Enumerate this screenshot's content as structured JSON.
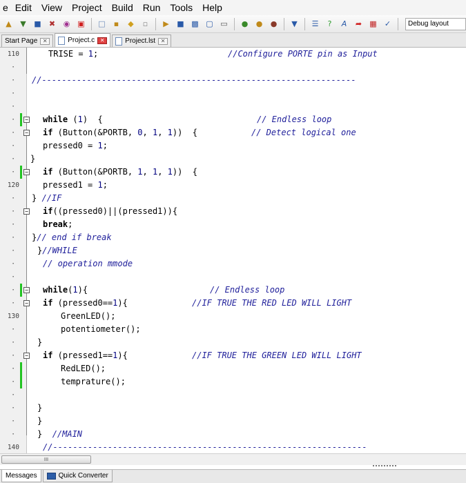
{
  "menu": [
    "Edit",
    "View",
    "Project",
    "Build",
    "Run",
    "Tools",
    "Help"
  ],
  "menu_partial": "e",
  "toolbar": {
    "layout_selected": "Debug layout"
  },
  "tabs": [
    {
      "label": "Start Page",
      "active": false
    },
    {
      "label": "Project.c",
      "active": true
    },
    {
      "label": "Project.lst",
      "active": false
    }
  ],
  "line_numbers": [
    {
      "row": 0,
      "label": "110"
    },
    {
      "row": 10,
      "label": "120"
    },
    {
      "row": 20,
      "label": "130"
    },
    {
      "row": 30,
      "label": "140"
    }
  ],
  "code": {
    "l0_a": "TRISE = ",
    "l0_n": "1",
    "l0_b": ";",
    "l0_c": "//Configure PORTE pin as Input",
    "l2": "//---------------------------------------------------------------",
    "l5_kw": "while",
    "l5_a": " (",
    "l5_n": "1",
    "l5_b": ")  {",
    "l5_c": "// Endless loop",
    "l6_kw": "if",
    "l6_a": " (Button(&PORTB, ",
    "l6_n1": "0",
    "l6_s1": ", ",
    "l6_n2": "1",
    "l6_s2": ", ",
    "l6_n3": "1",
    "l6_b": "))  {",
    "l6_c": "// Detect logical one",
    "l7_a": "pressed0 = ",
    "l7_n": "1",
    "l7_b": ";",
    "l8": "}",
    "l9_kw": "if",
    "l9_a": " (Button(&PORTB, ",
    "l9_n1": "1",
    "l9_s1": ", ",
    "l9_n2": "1",
    "l9_s2": ", ",
    "l9_n3": "1",
    "l9_b": "))  {",
    "l10_a": "pressed1 = ",
    "l10_n": "1",
    "l10_b": ";",
    "l11_a": "}",
    "l11_c": "//IF",
    "l12_kw": "if",
    "l12_a": "((pressed0)||(pressed1)){",
    "l13_kw": "break",
    "l13_a": ";",
    "l14_a": "}",
    "l14_c": "// end if break",
    "l15_a": "}",
    "l15_c": "//WHILE",
    "l16_c": "// operation mmode",
    "l18_kw": "while",
    "l18_a": "(",
    "l18_n": "1",
    "l18_b": "){",
    "l18_c": "// Endless loop",
    "l19_kw": "if",
    "l19_a": " (pressed0==",
    "l19_n": "1",
    "l19_b": "){",
    "l19_c": "//IF TRUE THE RED LED WILL LIGHT",
    "l20": "GreenLED();",
    "l21": "potentiometer();",
    "l22": "}",
    "l23_kw": "if",
    "l23_a": " (pressed1==",
    "l23_n": "1",
    "l23_b": "){",
    "l23_c": "//IF TRUE THE GREEN LED WILL LIGHT",
    "l24": "RedLED();",
    "l25": "temprature();",
    "l27": "}",
    "l28": "}",
    "l29_a": "}",
    "l29_c": "//MAIN",
    "l30": "//---------------------------------------------------------------"
  },
  "scrollbar_grip": "III",
  "bottom_tabs": [
    {
      "label": "Messages",
      "active": true
    },
    {
      "label": "Quick Converter",
      "active": false
    }
  ],
  "colors": {
    "comment": "#1e1e9a",
    "modified_marker": "#22c422",
    "active_tab_close": "#e04040"
  }
}
